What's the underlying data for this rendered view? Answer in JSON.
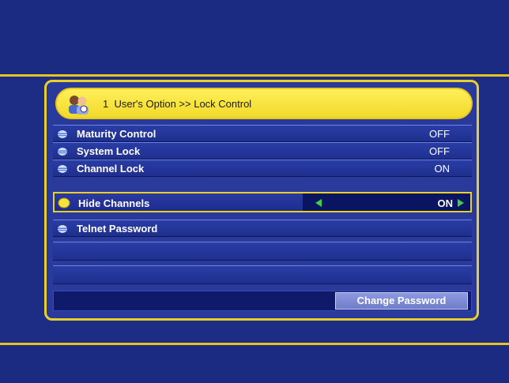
{
  "header": {
    "number": "1",
    "title": "User's Option >> Lock Control"
  },
  "rows": [
    {
      "label": "Maturity Control",
      "value": "OFF",
      "icon": "globe-icon"
    },
    {
      "label": "System Lock",
      "value": "OFF",
      "icon": "globe-icon"
    },
    {
      "label": "Channel Lock",
      "value": "ON",
      "icon": "globe-icon"
    },
    {
      "label": "Hide Channels",
      "value": "ON",
      "icon": "yellow-dot-icon",
      "selected": true
    },
    {
      "label": "Telnet Password",
      "value": "",
      "icon": "globe-icon"
    }
  ],
  "button": {
    "change_password": "Change Password"
  },
  "colors": {
    "accent": "#e8cf2c",
    "background": "#1d2d86",
    "selected_arrow": "#3fd04a"
  }
}
